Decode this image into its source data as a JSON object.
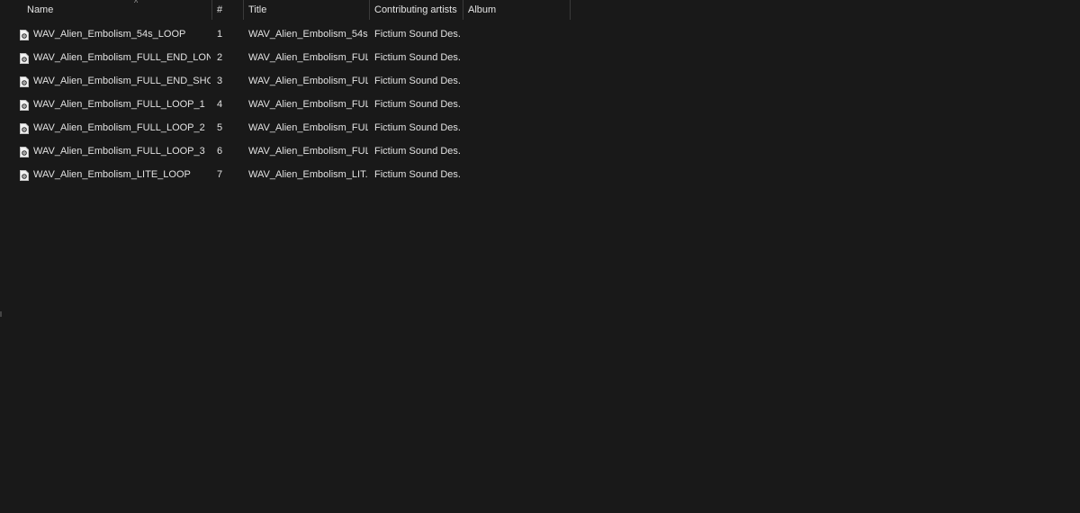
{
  "columns": {
    "name": "Name",
    "number": "#",
    "title": "Title",
    "artists": "Contributing artists",
    "album": "Album"
  },
  "sort_indicator": "^",
  "files": [
    {
      "name": "WAV_Alien_Embolism_54s_LOOP",
      "number": "1",
      "title": "WAV_Alien_Embolism_54s...",
      "artist": "Fictium Sound Des...",
      "album": "",
      "icon": "audio-file-icon"
    },
    {
      "name": "WAV_Alien_Embolism_FULL_END_LONG",
      "number": "2",
      "title": "WAV_Alien_Embolism_FUL...",
      "artist": "Fictium Sound Des...",
      "album": "",
      "icon": "audio-file-icon"
    },
    {
      "name": "WAV_Alien_Embolism_FULL_END_SHORT",
      "number": "3",
      "title": "WAV_Alien_Embolism_FUL...",
      "artist": "Fictium Sound Des...",
      "album": "",
      "icon": "audio-file-icon"
    },
    {
      "name": "WAV_Alien_Embolism_FULL_LOOP_1",
      "number": "4",
      "title": "WAV_Alien_Embolism_FUL...",
      "artist": "Fictium Sound Des...",
      "album": "",
      "icon": "audio-file-icon"
    },
    {
      "name": "WAV_Alien_Embolism_FULL_LOOP_2",
      "number": "5",
      "title": "WAV_Alien_Embolism_FUL...",
      "artist": "Fictium Sound Des...",
      "album": "",
      "icon": "audio-file-icon"
    },
    {
      "name": "WAV_Alien_Embolism_FULL_LOOP_3",
      "number": "6",
      "title": "WAV_Alien_Embolism_FUL...",
      "artist": "Fictium Sound Des...",
      "album": "",
      "icon": "audio-file-icon"
    },
    {
      "name": "WAV_Alien_Embolism_LITE_LOOP",
      "number": "7",
      "title": "WAV_Alien_Embolism_LIT...",
      "artist": "Fictium Sound Des...",
      "album": "",
      "icon": "audio-file-icon"
    }
  ],
  "colors": {
    "background": "#191919",
    "text": "#e2e2e2",
    "divider": "#3a3a3a"
  }
}
